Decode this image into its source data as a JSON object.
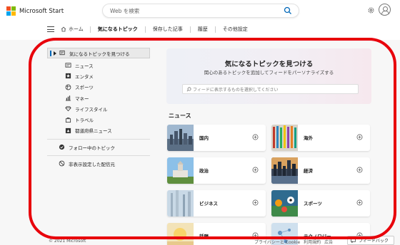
{
  "brand": {
    "name": "Microsoft Start"
  },
  "search": {
    "placeholder": "Web を検索"
  },
  "nav": {
    "home": "ホーム",
    "items": [
      "気になるトピック",
      "保存した記事",
      "履歴",
      "その他設定"
    ]
  },
  "sidebar": {
    "header": "気になるトピックを見つける",
    "items": [
      {
        "label": "ニュース",
        "icon": "news-icon"
      },
      {
        "label": "エンタメ",
        "icon": "star-icon"
      },
      {
        "label": "スポーツ",
        "icon": "ball-icon"
      },
      {
        "label": "マネー",
        "icon": "chart-icon"
      },
      {
        "label": "ライフスタイル",
        "icon": "gem-icon"
      },
      {
        "label": "トラベル",
        "icon": "suitcase-icon"
      },
      {
        "label": "都道府県ニュース",
        "icon": "map-icon"
      }
    ],
    "followed": "フォロー中のトピック",
    "hidden": "非表示設定した配信元"
  },
  "hero": {
    "title": "気になるトピックを見つける",
    "subtitle": "関心のあるトピックを追加してフィードをパーソナライズする",
    "search_placeholder": "フィードに表示するものを選択してください"
  },
  "section": {
    "title": "ニュース"
  },
  "cards": [
    {
      "label": "国内"
    },
    {
      "label": "海外"
    },
    {
      "label": "政治"
    },
    {
      "label": "経済"
    },
    {
      "label": "ビジネス"
    },
    {
      "label": "スポーツ"
    },
    {
      "label": "話題"
    },
    {
      "label": "テクノロジー"
    }
  ],
  "footer": {
    "copyright": "© 2021 Microsoft",
    "links": [
      "プライバシーと Cookie",
      "利用規約",
      "広告"
    ],
    "feedback": "フィードバック"
  },
  "colors": {
    "accent": "#0067b8",
    "annotation": "#e8000b"
  }
}
